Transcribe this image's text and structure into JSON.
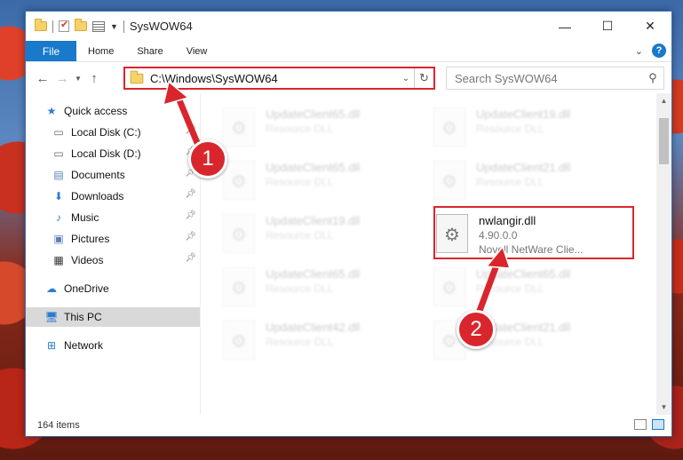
{
  "window": {
    "title": "SysWOW64",
    "minimize": "—",
    "maximize": "☐",
    "close": "✕"
  },
  "ribbon": {
    "tabs": [
      "File",
      "Home",
      "Share",
      "View"
    ],
    "help": "?"
  },
  "nav": {
    "back": "←",
    "forward": "→",
    "up": "↑",
    "address": "C:\\Windows\\SysWOW64",
    "search_placeholder": "Search SysWOW64"
  },
  "sidebar": {
    "items": [
      {
        "label": "Quick access",
        "icon": "star-icon",
        "pinned": false
      },
      {
        "label": "Local Disk (C:)",
        "icon": "drive-icon",
        "pinned": true
      },
      {
        "label": "Local Disk (D:)",
        "icon": "drive-icon",
        "pinned": true
      },
      {
        "label": "Documents",
        "icon": "documents-icon",
        "pinned": true
      },
      {
        "label": "Downloads",
        "icon": "download-icon",
        "pinned": true
      },
      {
        "label": "Music",
        "icon": "music-icon",
        "pinned": true
      },
      {
        "label": "Pictures",
        "icon": "pictures-icon",
        "pinned": true
      },
      {
        "label": "Videos",
        "icon": "video-icon",
        "pinned": true
      },
      {
        "label": "OneDrive",
        "icon": "cloud-icon",
        "pinned": false
      },
      {
        "label": "This PC",
        "icon": "computer-icon",
        "pinned": false,
        "selected": true
      },
      {
        "label": "Network",
        "icon": "network-icon",
        "pinned": false
      }
    ]
  },
  "files": [
    {
      "name": "UpdateClient65.dll",
      "desc": "Resource DLL"
    },
    {
      "name": "UpdateClient19.dll",
      "desc": "Resource DLL"
    },
    {
      "name": "UpdateClient65.dll",
      "desc": "Resource DLL"
    },
    {
      "name": "UpdateClient21.dll",
      "desc": "Resource DLL"
    },
    {
      "name": "UpdateClient19.dll",
      "desc": "Resource DLL"
    },
    {
      "name": "nwlangir.dll",
      "version": "4.90.0.0",
      "desc": "Novell NetWare Clie..."
    },
    {
      "name": "UpdateClient65.dll",
      "desc": "Resource DLL"
    },
    {
      "name": "UpdateClient65.dll",
      "desc": "Resource DLL"
    },
    {
      "name": "UpdateClient42.dll",
      "desc": "Resource DLL"
    },
    {
      "name": "UpdateClient21.dll",
      "desc": "Resource DLL"
    }
  ],
  "status": {
    "item_count": "164 items"
  },
  "annotations": {
    "step1": "1",
    "step2": "2",
    "color": "#d9262c"
  }
}
